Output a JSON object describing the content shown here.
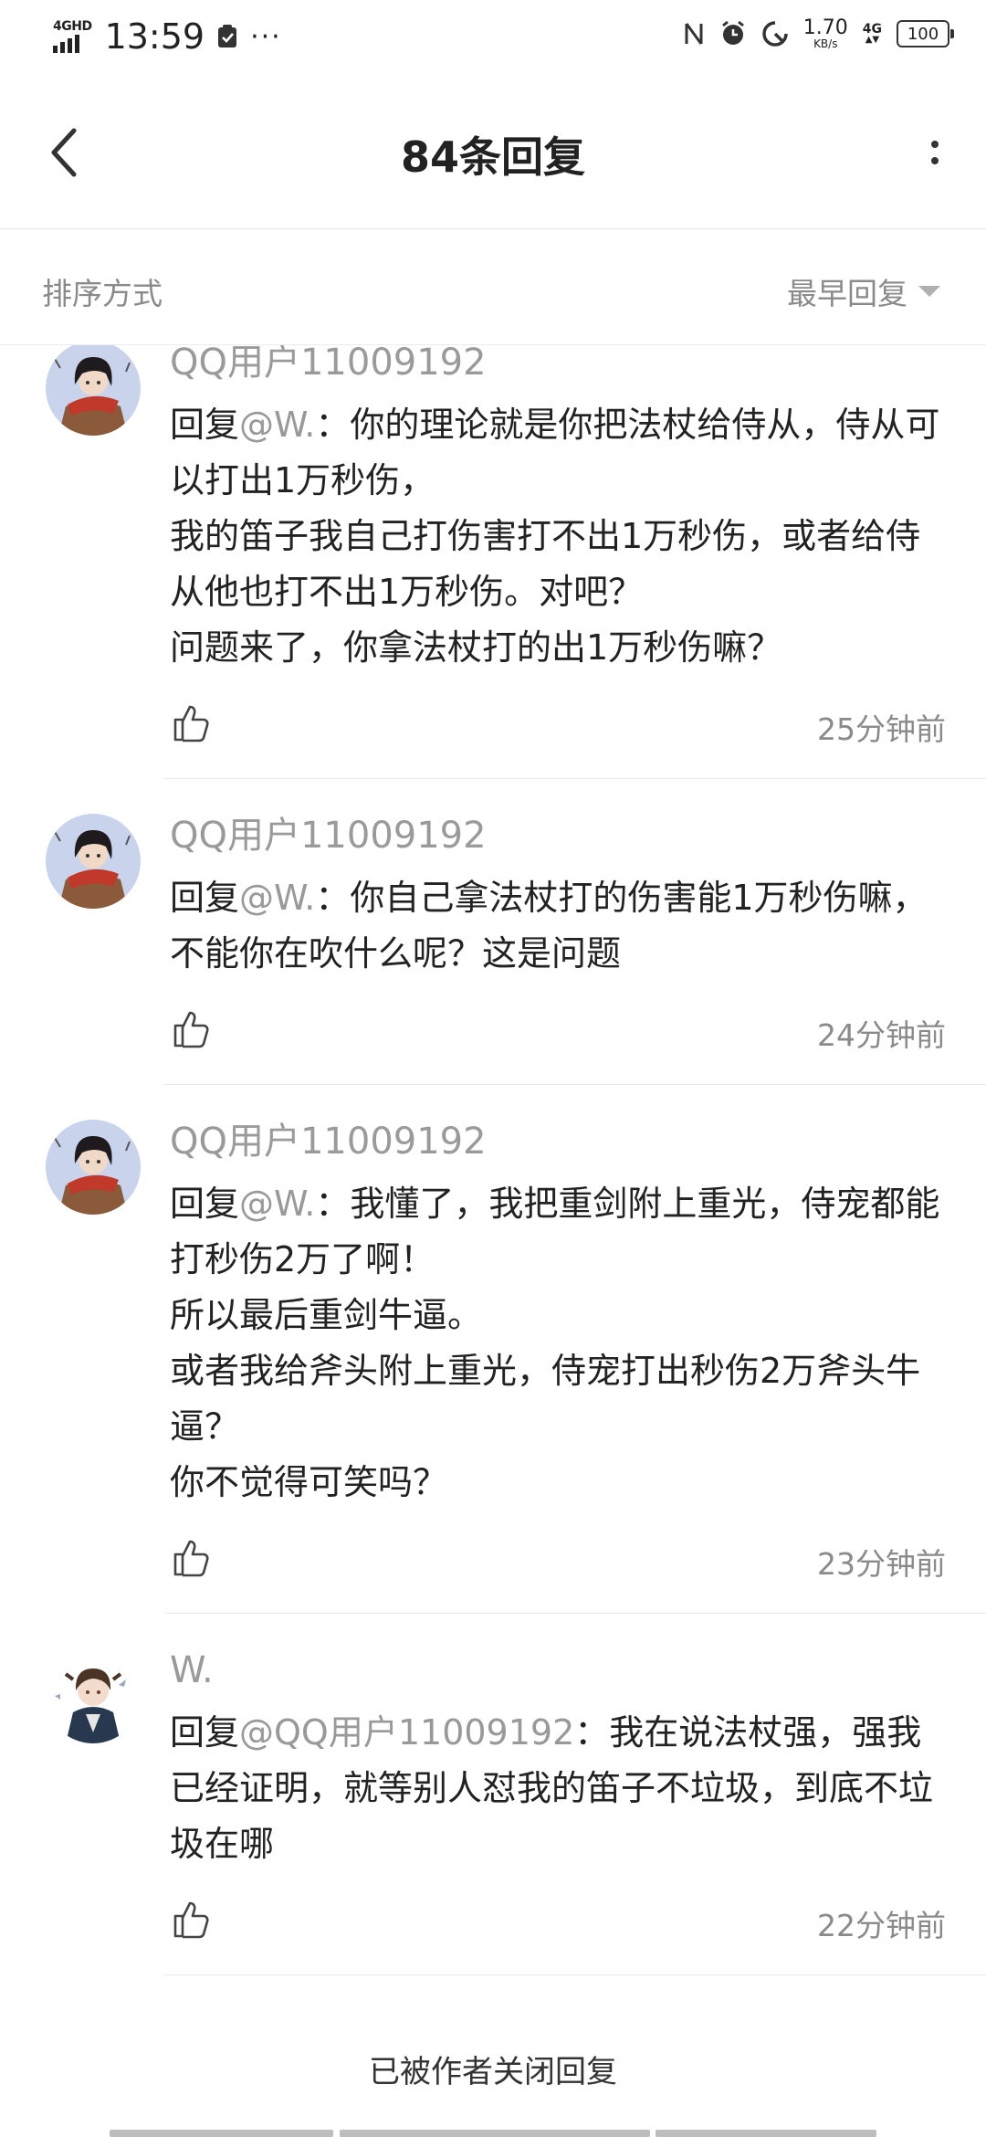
{
  "status_bar": {
    "network_top": "4GHD",
    "time": "13:59",
    "more": "···",
    "speed_value": "1.70",
    "speed_unit": "KB/s",
    "net_type": "4G",
    "battery": "100"
  },
  "header": {
    "title": "84条回复"
  },
  "sort": {
    "label": "排序方式",
    "value": "最早回复"
  },
  "comments": [
    {
      "user": "QQ用户11009192",
      "mention": "@W.",
      "reply_prefix": "回复",
      "text": "：你的理论就是你把法杖给侍从，侍从可以打出1万秒伤，\n我的笛子我自己打伤害打不出1万秒伤，或者给侍从他也打不出1万秒伤。对吧？\n问题来了，你拿法杖打的出1万秒伤嘛？",
      "time": "25分钟前",
      "avatar": "avatar-red-scarf"
    },
    {
      "user": "QQ用户11009192",
      "mention": "@W.",
      "reply_prefix": "回复",
      "text": "：你自己拿法杖打的伤害能1万秒伤嘛，不能你在吹什么呢？这是问题",
      "time": "24分钟前",
      "avatar": "avatar-red-scarf"
    },
    {
      "user": "QQ用户11009192",
      "mention": "@W.",
      "reply_prefix": "回复",
      "text": "：我懂了，我把重剑附上重光，侍宠都能打秒伤2万了啊！\n所以最后重剑牛逼。\n或者我给斧头附上重光，侍宠打出秒伤2万斧头牛逼？\n你不觉得可笑吗？",
      "time": "23分钟前",
      "avatar": "avatar-red-scarf"
    },
    {
      "user": "W.",
      "mention": "@QQ用户11009192",
      "reply_prefix": "回复",
      "text": "：我在说法杖强，强我已经证明，就等别人怼我的笛子不垃圾，到底不垃圾在哪",
      "time": "22分钟前",
      "avatar": "avatar-dark-coat"
    }
  ],
  "footer": {
    "closed_text": "已被作者关闭回复"
  },
  "colors": {
    "text": "#222222",
    "muted": "#8a8a8a",
    "username": "#9a9a9a",
    "divider": "#e8e8e8",
    "avatar_scarf": "#c0392b",
    "avatar_bg": "#c9d3ec"
  }
}
